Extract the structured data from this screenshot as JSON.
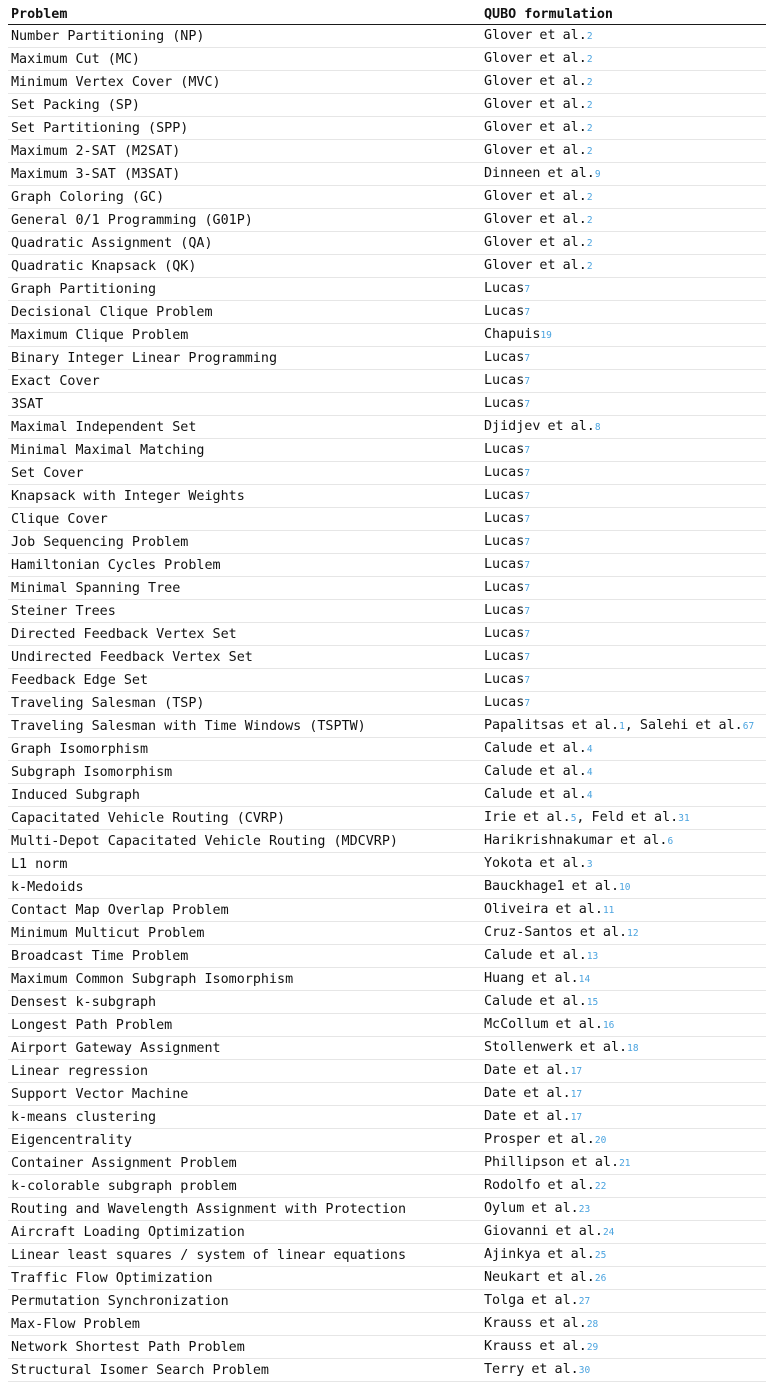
{
  "headers": {
    "problem": "Problem",
    "formulation": "QUBO formulation"
  },
  "colors": {
    "citation": "#4aa3df",
    "text": "#111111",
    "rule": "#1a1a1a",
    "row_separator": "#e6e6e6"
  },
  "rows": [
    {
      "problem": "Number Partitioning (NP)",
      "refs": [
        {
          "author": "Glover et al.",
          "cite": "2"
        }
      ]
    },
    {
      "problem": "Maximum Cut (MC)",
      "refs": [
        {
          "author": "Glover et al.",
          "cite": "2"
        }
      ]
    },
    {
      "problem": "Minimum Vertex Cover (MVC)",
      "refs": [
        {
          "author": "Glover et al.",
          "cite": "2"
        }
      ]
    },
    {
      "problem": "Set Packing (SP)",
      "refs": [
        {
          "author": "Glover et al.",
          "cite": "2"
        }
      ]
    },
    {
      "problem": "Set Partitioning (SPP)",
      "refs": [
        {
          "author": "Glover et al.",
          "cite": "2"
        }
      ]
    },
    {
      "problem": "Maximum 2-SAT (M2SAT)",
      "refs": [
        {
          "author": "Glover et al.",
          "cite": "2"
        }
      ]
    },
    {
      "problem": "Maximum 3-SAT (M3SAT)",
      "refs": [
        {
          "author": "Dinneen et al.",
          "cite": "9"
        }
      ]
    },
    {
      "problem": "Graph Coloring (GC)",
      "refs": [
        {
          "author": "Glover et al.",
          "cite": "2"
        }
      ]
    },
    {
      "problem": "General 0/1 Programming (G01P)",
      "refs": [
        {
          "author": "Glover et al.",
          "cite": "2"
        }
      ]
    },
    {
      "problem": "Quadratic Assignment (QA)",
      "refs": [
        {
          "author": "Glover et al.",
          "cite": "2"
        }
      ]
    },
    {
      "problem": "Quadratic Knapsack (QK)",
      "refs": [
        {
          "author": "Glover et al.",
          "cite": "2"
        }
      ]
    },
    {
      "problem": "Graph Partitioning",
      "refs": [
        {
          "author": "Lucas",
          "cite": "7"
        }
      ]
    },
    {
      "problem": "Decisional Clique Problem",
      "refs": [
        {
          "author": "Lucas",
          "cite": "7"
        }
      ]
    },
    {
      "problem": "Maximum Clique Problem",
      "refs": [
        {
          "author": "Chapuis",
          "cite": "19"
        }
      ]
    },
    {
      "problem": "Binary Integer Linear Programming",
      "refs": [
        {
          "author": "Lucas",
          "cite": "7"
        }
      ]
    },
    {
      "problem": "Exact Cover",
      "refs": [
        {
          "author": "Lucas",
          "cite": "7"
        }
      ]
    },
    {
      "problem": "3SAT",
      "refs": [
        {
          "author": "Lucas",
          "cite": "7"
        }
      ]
    },
    {
      "problem": "Maximal Independent Set",
      "refs": [
        {
          "author": "Djidjev et al.",
          "cite": "8"
        }
      ]
    },
    {
      "problem": "Minimal Maximal Matching",
      "refs": [
        {
          "author": "Lucas",
          "cite": "7"
        }
      ]
    },
    {
      "problem": "Set Cover",
      "refs": [
        {
          "author": "Lucas",
          "cite": "7"
        }
      ]
    },
    {
      "problem": "Knapsack with Integer Weights",
      "refs": [
        {
          "author": "Lucas",
          "cite": "7"
        }
      ]
    },
    {
      "problem": "Clique Cover",
      "refs": [
        {
          "author": "Lucas",
          "cite": "7"
        }
      ]
    },
    {
      "problem": "Job Sequencing Problem",
      "refs": [
        {
          "author": "Lucas",
          "cite": "7"
        }
      ]
    },
    {
      "problem": "Hamiltonian Cycles Problem",
      "refs": [
        {
          "author": "Lucas",
          "cite": "7"
        }
      ]
    },
    {
      "problem": "Minimal Spanning Tree",
      "refs": [
        {
          "author": "Lucas",
          "cite": "7"
        }
      ]
    },
    {
      "problem": "Steiner Trees",
      "refs": [
        {
          "author": "Lucas",
          "cite": "7"
        }
      ]
    },
    {
      "problem": "Directed Feedback Vertex Set",
      "refs": [
        {
          "author": "Lucas",
          "cite": "7"
        }
      ]
    },
    {
      "problem": "Undirected Feedback Vertex Set",
      "refs": [
        {
          "author": "Lucas",
          "cite": "7"
        }
      ]
    },
    {
      "problem": "Feedback Edge Set",
      "refs": [
        {
          "author": "Lucas",
          "cite": "7"
        }
      ]
    },
    {
      "problem": "Traveling Salesman (TSP)",
      "refs": [
        {
          "author": "Lucas",
          "cite": "7"
        }
      ]
    },
    {
      "problem": "Traveling Salesman with Time Windows (TSPTW)",
      "justify": true,
      "refs": [
        {
          "author": "Papalitsas et al.",
          "cite": "1"
        },
        {
          "author": "Salehi et al.",
          "cite": "67"
        }
      ]
    },
    {
      "problem": "Graph Isomorphism",
      "refs": [
        {
          "author": "Calude et al.",
          "cite": "4"
        }
      ]
    },
    {
      "problem": "Subgraph Isomorphism",
      "refs": [
        {
          "author": "Calude et al.",
          "cite": "4"
        }
      ]
    },
    {
      "problem": "Induced Subgraph",
      "refs": [
        {
          "author": "Calude et al.",
          "cite": "4"
        }
      ]
    },
    {
      "problem": "Capacitated Vehicle Routing (CVRP)",
      "refs": [
        {
          "author": "Irie et al.",
          "cite": "5"
        },
        {
          "author": "Feld et al.",
          "cite": "31"
        }
      ]
    },
    {
      "problem": "Multi-Depot Capacitated Vehicle Routing (MDCVRP)",
      "refs": [
        {
          "author": "Harikrishnakumar et al.",
          "cite": "6"
        }
      ]
    },
    {
      "problem": "L1 norm",
      "refs": [
        {
          "author": "Yokota et al.",
          "cite": "3"
        }
      ]
    },
    {
      "problem": "k-Medoids",
      "refs": [
        {
          "author": "Bauckhage1 et al.",
          "cite": "10"
        }
      ]
    },
    {
      "problem": "Contact Map Overlap Problem",
      "refs": [
        {
          "author": "Oliveira et al.",
          "cite": "11"
        }
      ]
    },
    {
      "problem": "Minimum Multicut Problem",
      "refs": [
        {
          "author": "Cruz-Santos et al.",
          "cite": "12"
        }
      ]
    },
    {
      "problem": "Broadcast Time Problem",
      "refs": [
        {
          "author": "Calude et al.",
          "cite": "13"
        }
      ]
    },
    {
      "problem": "Maximum Common Subgraph Isomorphism",
      "refs": [
        {
          "author": "Huang et al.",
          "cite": "14"
        }
      ]
    },
    {
      "problem": "Densest k-subgraph",
      "refs": [
        {
          "author": "Calude et al.",
          "cite": "15"
        }
      ]
    },
    {
      "problem": "Longest Path Problem",
      "refs": [
        {
          "author": "McCollum et al.",
          "cite": "16"
        }
      ]
    },
    {
      "problem": "Airport Gateway Assignment",
      "refs": [
        {
          "author": "Stollenwerk et al.",
          "cite": "18"
        }
      ]
    },
    {
      "problem": "Linear regression",
      "refs": [
        {
          "author": "Date et al.",
          "cite": "17"
        }
      ]
    },
    {
      "problem": "Support Vector Machine",
      "refs": [
        {
          "author": "Date et al.",
          "cite": "17"
        }
      ]
    },
    {
      "problem": "k-means clustering",
      "refs": [
        {
          "author": "Date et al.",
          "cite": "17"
        }
      ]
    },
    {
      "problem": "Eigencentrality",
      "refs": [
        {
          "author": "Prosper et al.",
          "cite": "20"
        }
      ]
    },
    {
      "problem": "Container Assignment Problem",
      "refs": [
        {
          "author": "Phillipson et al.",
          "cite": "21"
        }
      ]
    },
    {
      "problem": "k-colorable subgraph problem",
      "refs": [
        {
          "author": "Rodolfo et al.",
          "cite": "22"
        }
      ]
    },
    {
      "problem": "Routing and Wavelength Assignment with Protection",
      "refs": [
        {
          "author": "Oylum et al.",
          "cite": "23"
        }
      ]
    },
    {
      "problem": "Aircraft Loading Optimization",
      "refs": [
        {
          "author": "Giovanni et al.",
          "cite": "24"
        }
      ]
    },
    {
      "problem": "Linear least squares / system of linear equations",
      "refs": [
        {
          "author": "Ajinkya et al.",
          "cite": "25"
        }
      ]
    },
    {
      "problem": "Traffic Flow Optimization",
      "refs": [
        {
          "author": "Neukart et al.",
          "cite": "26"
        }
      ]
    },
    {
      "problem": "Permutation Synchronization",
      "refs": [
        {
          "author": "Tolga et al.",
          "cite": "27"
        }
      ]
    },
    {
      "problem": "Max-Flow Problem",
      "refs": [
        {
          "author": "Krauss et al.",
          "cite": "28"
        }
      ]
    },
    {
      "problem": "Network Shortest Path Problem",
      "refs": [
        {
          "author": "Krauss et al.",
          "cite": "29"
        }
      ]
    },
    {
      "problem": "Structural Isomer Search Problem",
      "refs": [
        {
          "author": "Terry et al.",
          "cite": "30"
        }
      ]
    }
  ]
}
